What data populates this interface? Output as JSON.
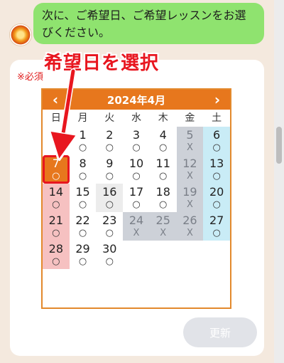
{
  "chat": {
    "message": "次に、ご希望日、ご希望レッスンをお選びください。"
  },
  "form": {
    "required_label": "※必須",
    "update_button": "更新"
  },
  "annotation": {
    "text": "希望日を選択",
    "color": "#e8161f"
  },
  "calendar": {
    "month_label": "2024年4月",
    "prev_icon": "chevron-left-icon",
    "next_icon": "chevron-right-icon",
    "prev_label": "‹",
    "next_label": "›",
    "weekdays": [
      "日",
      "月",
      "火",
      "水",
      "木",
      "金",
      "土"
    ],
    "header_color": "#e7771d",
    "weeks": [
      [
        null,
        {
          "d": "1",
          "m": "○"
        },
        {
          "d": "2",
          "m": "○"
        },
        {
          "d": "3",
          "m": "○"
        },
        {
          "d": "4",
          "m": "○"
        },
        {
          "d": "5",
          "m": "X",
          "closed": true
        },
        {
          "d": "6",
          "m": "○"
        }
      ],
      [
        {
          "d": "7",
          "m": "○",
          "selected": true
        },
        {
          "d": "8",
          "m": "○"
        },
        {
          "d": "9",
          "m": "○"
        },
        {
          "d": "10",
          "m": "○"
        },
        {
          "d": "11",
          "m": "○"
        },
        {
          "d": "12",
          "m": "X",
          "closed": true
        },
        {
          "d": "13",
          "m": "○"
        }
      ],
      [
        {
          "d": "14",
          "m": "○"
        },
        {
          "d": "15",
          "m": "○"
        },
        {
          "d": "16",
          "m": "○",
          "today": true
        },
        {
          "d": "17",
          "m": "○"
        },
        {
          "d": "18",
          "m": "○"
        },
        {
          "d": "19",
          "m": "X",
          "closed": true
        },
        {
          "d": "20",
          "m": "○"
        }
      ],
      [
        {
          "d": "21",
          "m": "○"
        },
        {
          "d": "22",
          "m": "○"
        },
        {
          "d": "23",
          "m": "○"
        },
        {
          "d": "24",
          "m": "X",
          "closed": true
        },
        {
          "d": "25",
          "m": "X",
          "closed": true
        },
        {
          "d": "26",
          "m": "X",
          "closed": true
        },
        {
          "d": "27",
          "m": "○"
        }
      ],
      [
        {
          "d": "28",
          "m": "○"
        },
        {
          "d": "29",
          "m": "○"
        },
        {
          "d": "30",
          "m": "○"
        },
        null,
        null,
        null,
        null
      ]
    ]
  }
}
